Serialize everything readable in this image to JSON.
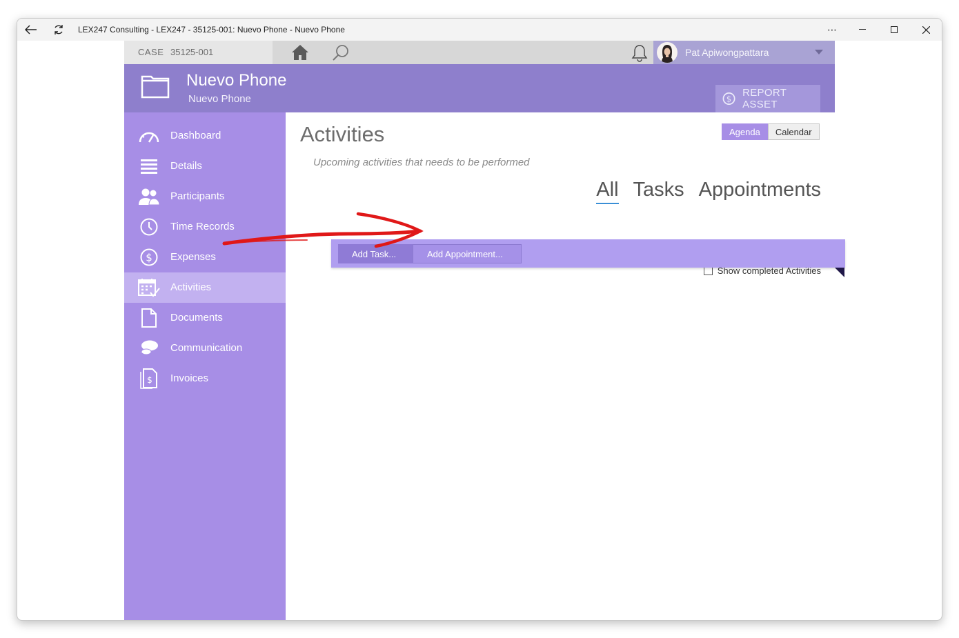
{
  "window": {
    "title": "LEX247 Consulting - LEX247 - 35125-001: Nuevo Phone - Nuevo Phone"
  },
  "topbar": {
    "case_label": "CASE",
    "case_number": "35125-001",
    "user_name": "Pat Apiwongpattara"
  },
  "header": {
    "case_title": "Nuevo Phone",
    "case_subtitle": "Nuevo Phone",
    "report_label": "REPORT ASSET"
  },
  "sidebar": {
    "items": [
      {
        "label": "Dashboard",
        "icon": "gauge-icon"
      },
      {
        "label": "Details",
        "icon": "list-icon"
      },
      {
        "label": "Participants",
        "icon": "people-icon"
      },
      {
        "label": "Time Records",
        "icon": "clock-icon"
      },
      {
        "label": "Expenses",
        "icon": "dollar-icon"
      },
      {
        "label": "Activities",
        "icon": "calendar-check-icon",
        "active": true
      },
      {
        "label": "Documents",
        "icon": "document-icon"
      },
      {
        "label": "Communication",
        "icon": "chat-icon"
      },
      {
        "label": "Invoices",
        "icon": "invoice-icon"
      }
    ]
  },
  "main": {
    "title": "Activities",
    "subtitle": "Upcoming activities that needs to be performed",
    "view_toggle": [
      "Agenda",
      "Calendar"
    ],
    "active_view": "Agenda",
    "filter_tabs": [
      "All",
      "Tasks",
      "Appointments"
    ],
    "active_filter": "All",
    "add_task_label": "Add Task...",
    "add_appointment_label": "Add Appointment...",
    "show_completed_label": "Show completed Activities",
    "show_completed_checked": false
  },
  "colors": {
    "header_purple": "#8e7fcc",
    "sidebar_purple": "#a78ee6",
    "active_item": "#c2b1f0",
    "action_bar": "#b09ef0",
    "annotation_red": "#e01818"
  }
}
